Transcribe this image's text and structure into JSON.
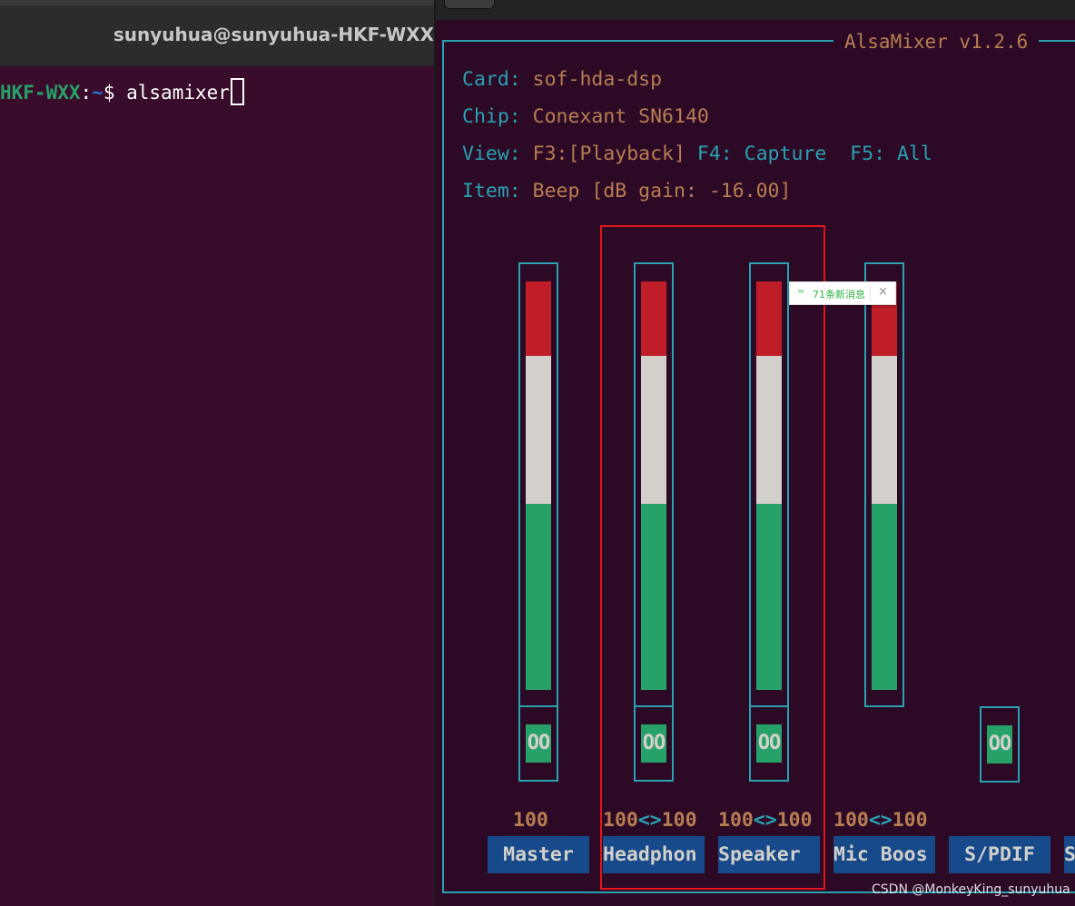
{
  "left_terminal": {
    "title": "sunyuhua@sunyuhua-HKF-WXX",
    "prompt_host": "HKF-WXX",
    "prompt_sep": ":",
    "prompt_path": "~",
    "prompt_symbol": "$ ",
    "command": "alsamixer"
  },
  "alsamixer": {
    "title": "AlsaMixer v1.2.6",
    "card_label": "Card: ",
    "card_value": "sof-hda-dsp",
    "chip_label": "Chip: ",
    "chip_value": "Conexant SN6140",
    "view_label": "View: ",
    "view_f3": "F3:[Playback]",
    "view_f4": " F4: Capture ",
    "view_f5": " F5: All",
    "item_label": "Item: ",
    "item_value": "Beep [dB gain: -16.00]",
    "controls": [
      {
        "name": "Master",
        "level": "100",
        "volume_percent": 100,
        "switch": "OO"
      },
      {
        "name": "Headphon",
        "level_left": "100",
        "level_arrows": "<>",
        "level_right": "100",
        "volume_percent": 100,
        "switch": "OO"
      },
      {
        "name": "Speaker",
        "level_left": "100",
        "level_arrows": "<>",
        "level_right": "100",
        "volume_percent": 100,
        "switch": "OO"
      },
      {
        "name": "Mic Boos",
        "level_left": "100",
        "level_arrows": "<>",
        "level_right": "100",
        "volume_percent": 100
      },
      {
        "name": "S/PDIF",
        "switch": "OO"
      },
      {
        "name": "S"
      }
    ]
  },
  "notification": {
    "arrow": "≈",
    "text": "71条新消息",
    "close": "×"
  },
  "watermark": "CSDN @MonkeyKing_sunyuhua",
  "colors": {
    "bar_red": "#bf1e28",
    "bar_white": "#d3d0cb",
    "bar_green": "#26a269",
    "frame": "#2aa1b3",
    "value_text": "#b87d52",
    "name_bg": "#174a8a",
    "highlight": "#e0161a"
  }
}
